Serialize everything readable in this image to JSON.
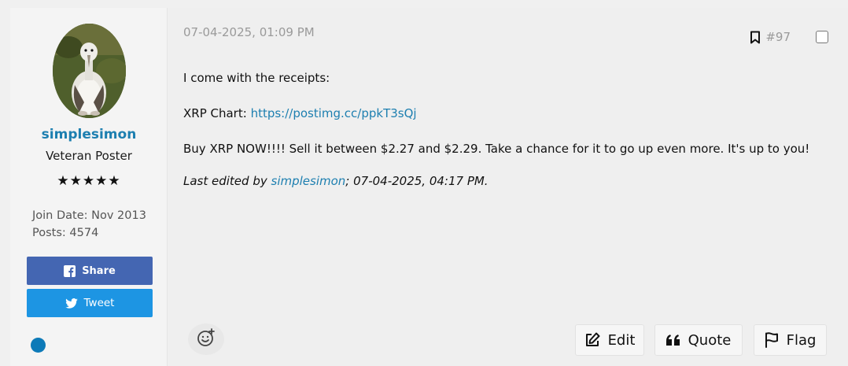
{
  "author": {
    "username": "simplesimon",
    "rank": "Veteran Poster",
    "stars": "★★★★★",
    "join_date": "Join Date: Nov 2013",
    "posts": "Posts: 4574"
  },
  "social": {
    "share_label": "Share",
    "tweet_label": "Tweet",
    "share_color": "#4466b2",
    "tweet_color": "#1d95e3"
  },
  "post": {
    "timestamp": "07-04-2025, 01:09 PM",
    "number": "#97",
    "line1": "I come with the receipts:",
    "chart_prefix": "XRP Chart: ",
    "chart_link": "https://postimg.cc/ppkT3sQj",
    "line3": "Buy XRP NOW!!!! Sell it between $2.27 and $2.29. Take a chance for it to go up even more. It's up to you!",
    "edited_prefix": "Last edited by ",
    "edited_user": "simplesimon",
    "edited_suffix": "; 07-04-2025, 04:17 PM."
  },
  "actions": {
    "edit_label": "Edit",
    "quote_label": "Quote",
    "flag_label": "Flag"
  },
  "icons": [
    "bookmark-icon",
    "facebook-icon",
    "twitter-icon",
    "smiley-add-icon",
    "edit-icon",
    "quote-icon",
    "flag-icon"
  ],
  "colors": {
    "link": "#1d7fb0",
    "online": "#0d7ab8"
  }
}
